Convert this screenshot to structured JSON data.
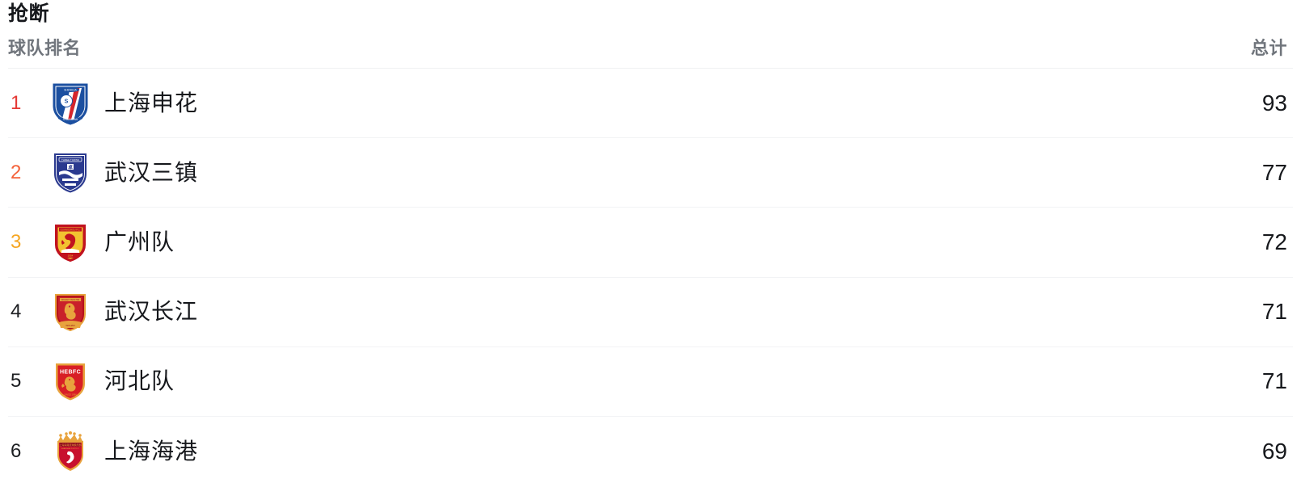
{
  "header": {
    "stat_title": "抢断",
    "col_team": "球队排名",
    "col_total": "总计"
  },
  "colors": {
    "rank_1": "#e53935",
    "rank_2": "#f4623a",
    "rank_3": "#f6a623",
    "rank_default": "#1c1e21",
    "text_primary": "#16181c",
    "text_muted": "#70757c",
    "divider": "#f2f3f5",
    "background": "#ffffff"
  },
  "chart_data": {
    "type": "table",
    "title": "抢断",
    "columns": [
      "球队排名",
      "总计"
    ],
    "categories": [
      "上海申花",
      "武汉三镇",
      "广州队",
      "武汉长江",
      "河北队",
      "上海海港"
    ],
    "values": [
      93,
      77,
      72,
      71,
      71,
      69
    ],
    "xlabel": "球队排名",
    "ylabel": "总计"
  },
  "rows": [
    {
      "rank": "1",
      "team": "上海申花",
      "total": "93",
      "crest": "shanghai-shenhua-crest"
    },
    {
      "rank": "2",
      "team": "武汉三镇",
      "total": "77",
      "crest": "wuhan-three-towns-crest"
    },
    {
      "rank": "3",
      "team": "广州队",
      "total": "72",
      "crest": "guangzhou-fc-crest"
    },
    {
      "rank": "4",
      "team": "武汉长江",
      "total": "71",
      "crest": "wuhan-yangtze-river-crest"
    },
    {
      "rank": "5",
      "team": "河北队",
      "total": "71",
      "crest": "hebei-fc-crest"
    },
    {
      "rank": "6",
      "team": "上海海港",
      "total": "69",
      "crest": "shanghai-port-crest"
    }
  ]
}
